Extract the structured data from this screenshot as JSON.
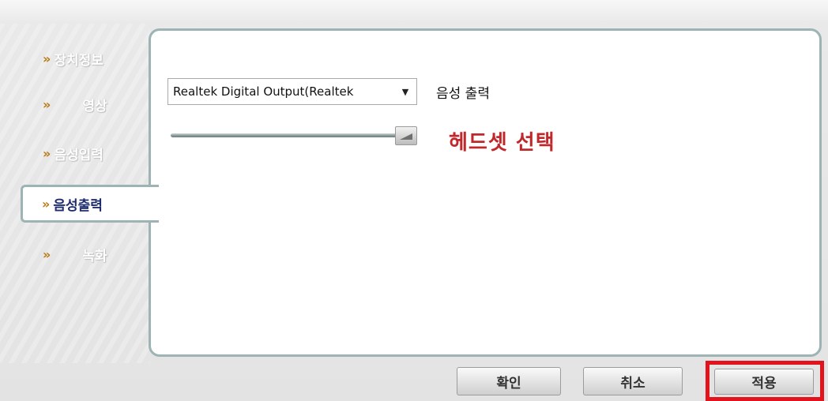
{
  "sidebar": {
    "items": [
      {
        "label": "장치정보",
        "active": false
      },
      {
        "label": "영상",
        "active": false
      },
      {
        "label": "음성입력",
        "active": false
      },
      {
        "label": "음성출력",
        "active": true
      },
      {
        "label": "녹화",
        "active": false
      }
    ],
    "chevron": "»"
  },
  "audio_output": {
    "device_value": "Realtek Digital Output(Realtek",
    "device_label": "음성 출력",
    "volume_level_fraction": 1.0,
    "annotation": "헤드셋 선택",
    "annotation_color": "#c0282b"
  },
  "buttons": {
    "ok_label": "확인",
    "cancel_label": "취소",
    "apply_label": "적용"
  },
  "colors": {
    "highlight": "#e2131d",
    "panel_border": "#9eb3b3",
    "active_text": "#1f2d6e"
  }
}
